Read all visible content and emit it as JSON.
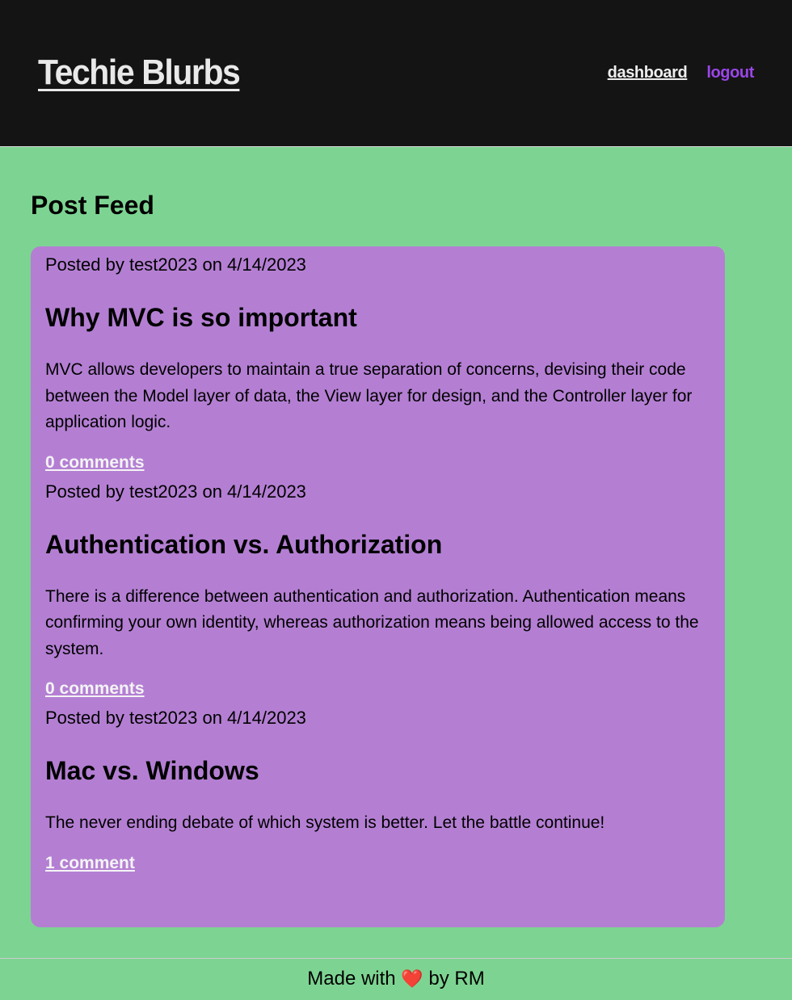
{
  "header": {
    "site_title": "Techie Blurbs",
    "nav": {
      "dashboard": "dashboard",
      "logout": "logout"
    }
  },
  "main": {
    "heading": "Post Feed",
    "posts": [
      {
        "meta": "Posted by test2023 on 4/14/2023",
        "title": "Why MVC is so important",
        "body": "MVC allows developers to maintain a true separation of concerns, devising their code between the Model layer of data, the View layer for design, and the Controller layer for application logic.",
        "comments": "0 comments"
      },
      {
        "meta": "Posted by test2023 on 4/14/2023",
        "title": "Authentication vs. Authorization",
        "body": "There is a difference between authentication and authorization. Authentication means confirming your own identity, whereas authorization means being allowed access to the system.",
        "comments": "0 comments"
      },
      {
        "meta": "Posted by test2023 on 4/14/2023",
        "title": "Mac vs. Windows",
        "body": "The never ending debate of which system is better. Let the battle continue!",
        "comments": "1 comment"
      }
    ]
  },
  "footer": {
    "prefix": "Made with",
    "heart": "❤️",
    "suffix": "by RM"
  },
  "colors": {
    "header_bg": "#141414",
    "page_bg": "#7dd492",
    "card_bg": "#b47fd3",
    "logout": "#9a45e8"
  }
}
